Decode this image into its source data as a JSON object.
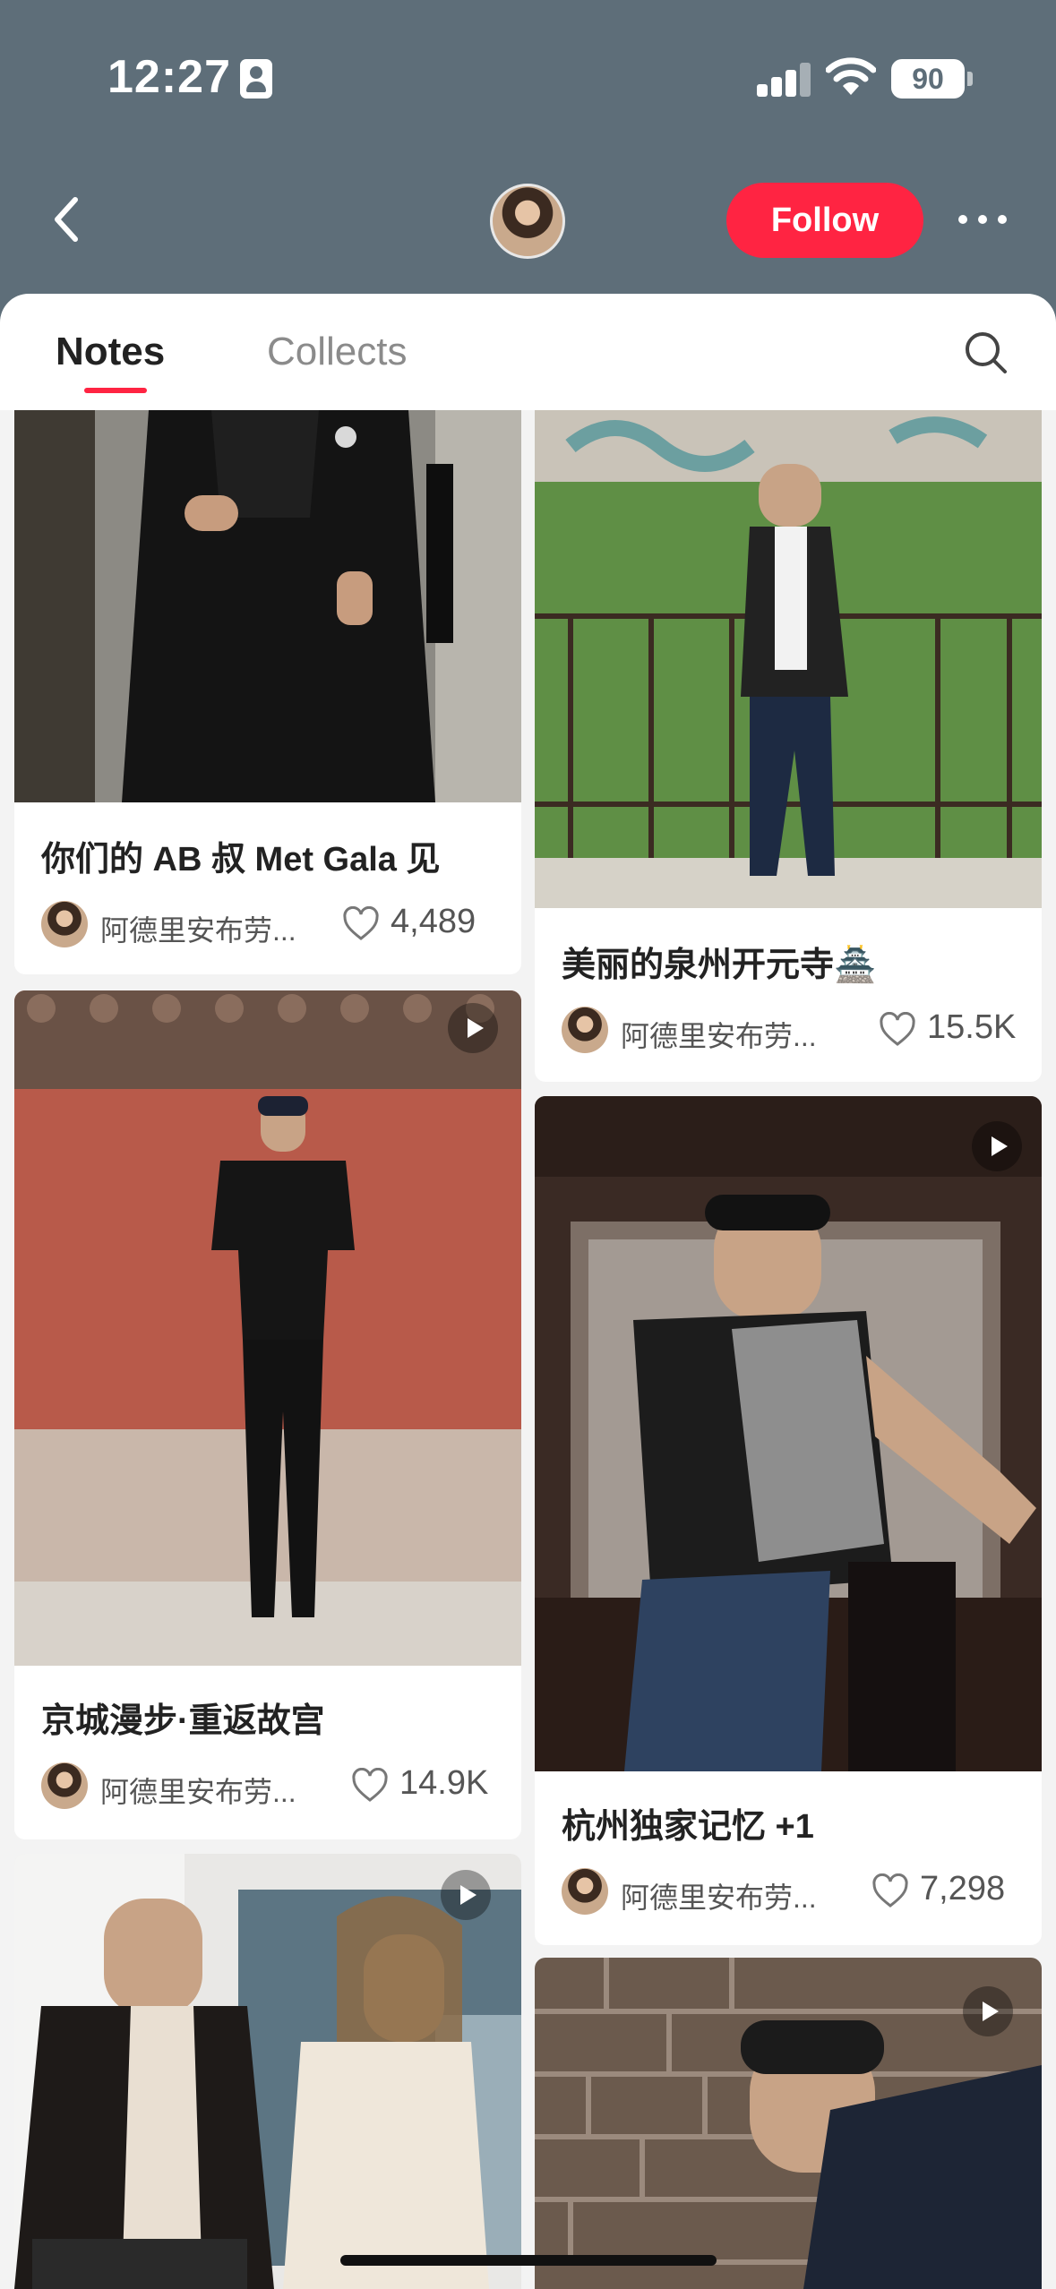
{
  "status_bar": {
    "time": "12:27",
    "battery": "90"
  },
  "header": {
    "follow_label": "Follow"
  },
  "tabs": {
    "notes": "Notes",
    "collects": "Collects"
  },
  "notes": [
    {
      "title": "你们的 AB 叔 Met Gala 见",
      "author": "阿德里安布劳...",
      "likes": "4,489"
    },
    {
      "title": "美丽的泉州开元寺🏯",
      "author": "阿德里安布劳...",
      "likes": "15.5K"
    },
    {
      "title": "京城漫步·重返故宫",
      "author": "阿德里安布劳...",
      "likes": "14.9K"
    },
    {
      "title": "杭州独家记忆 +1",
      "author": "阿德里安布劳...",
      "likes": "7,298"
    }
  ]
}
